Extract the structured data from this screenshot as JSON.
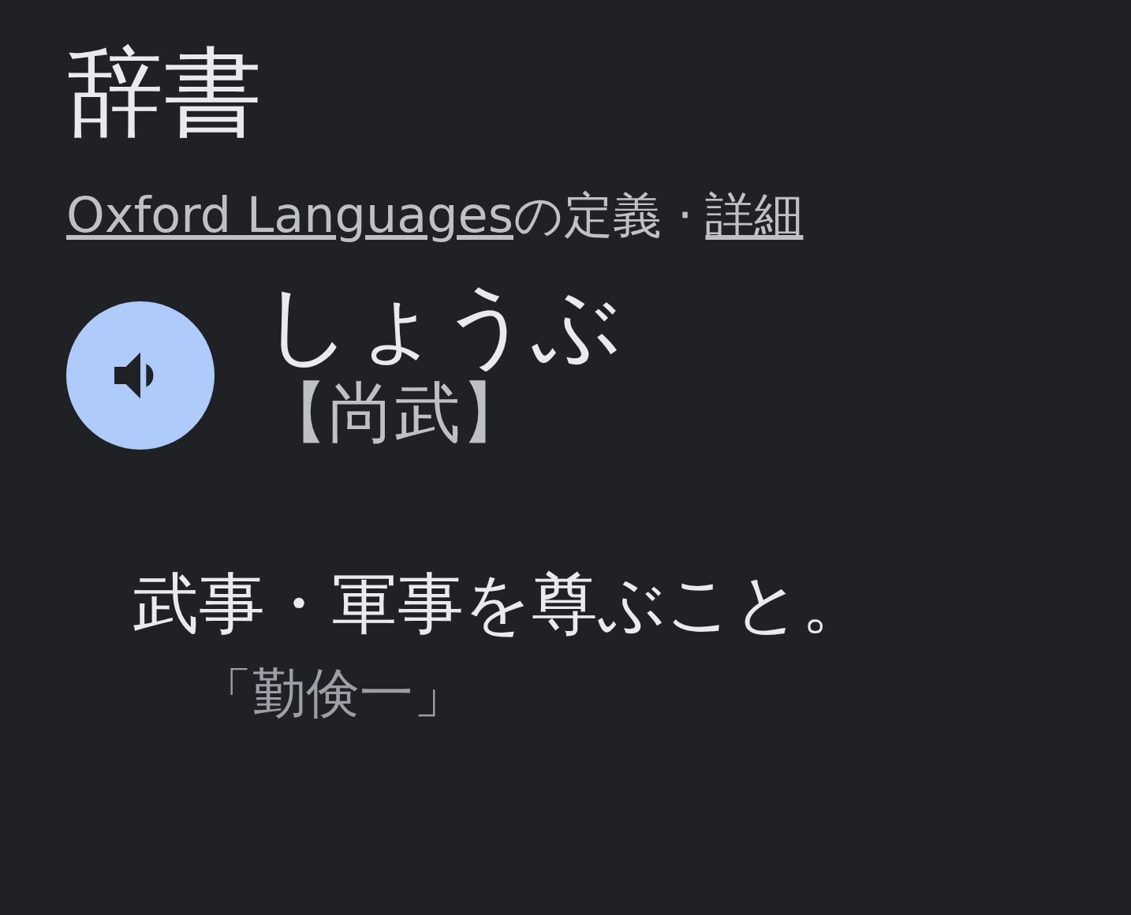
{
  "title": "辞書",
  "source": {
    "link": "Oxford Languages",
    "suffix": "の定義 ·",
    "details_link": "詳細"
  },
  "entry": {
    "reading": "しょうぶ",
    "kanji": "【尚武】"
  },
  "definitions": [
    {
      "text": "武事・軍事を尊ぶこと。",
      "example": "「勤倹一」"
    }
  ]
}
